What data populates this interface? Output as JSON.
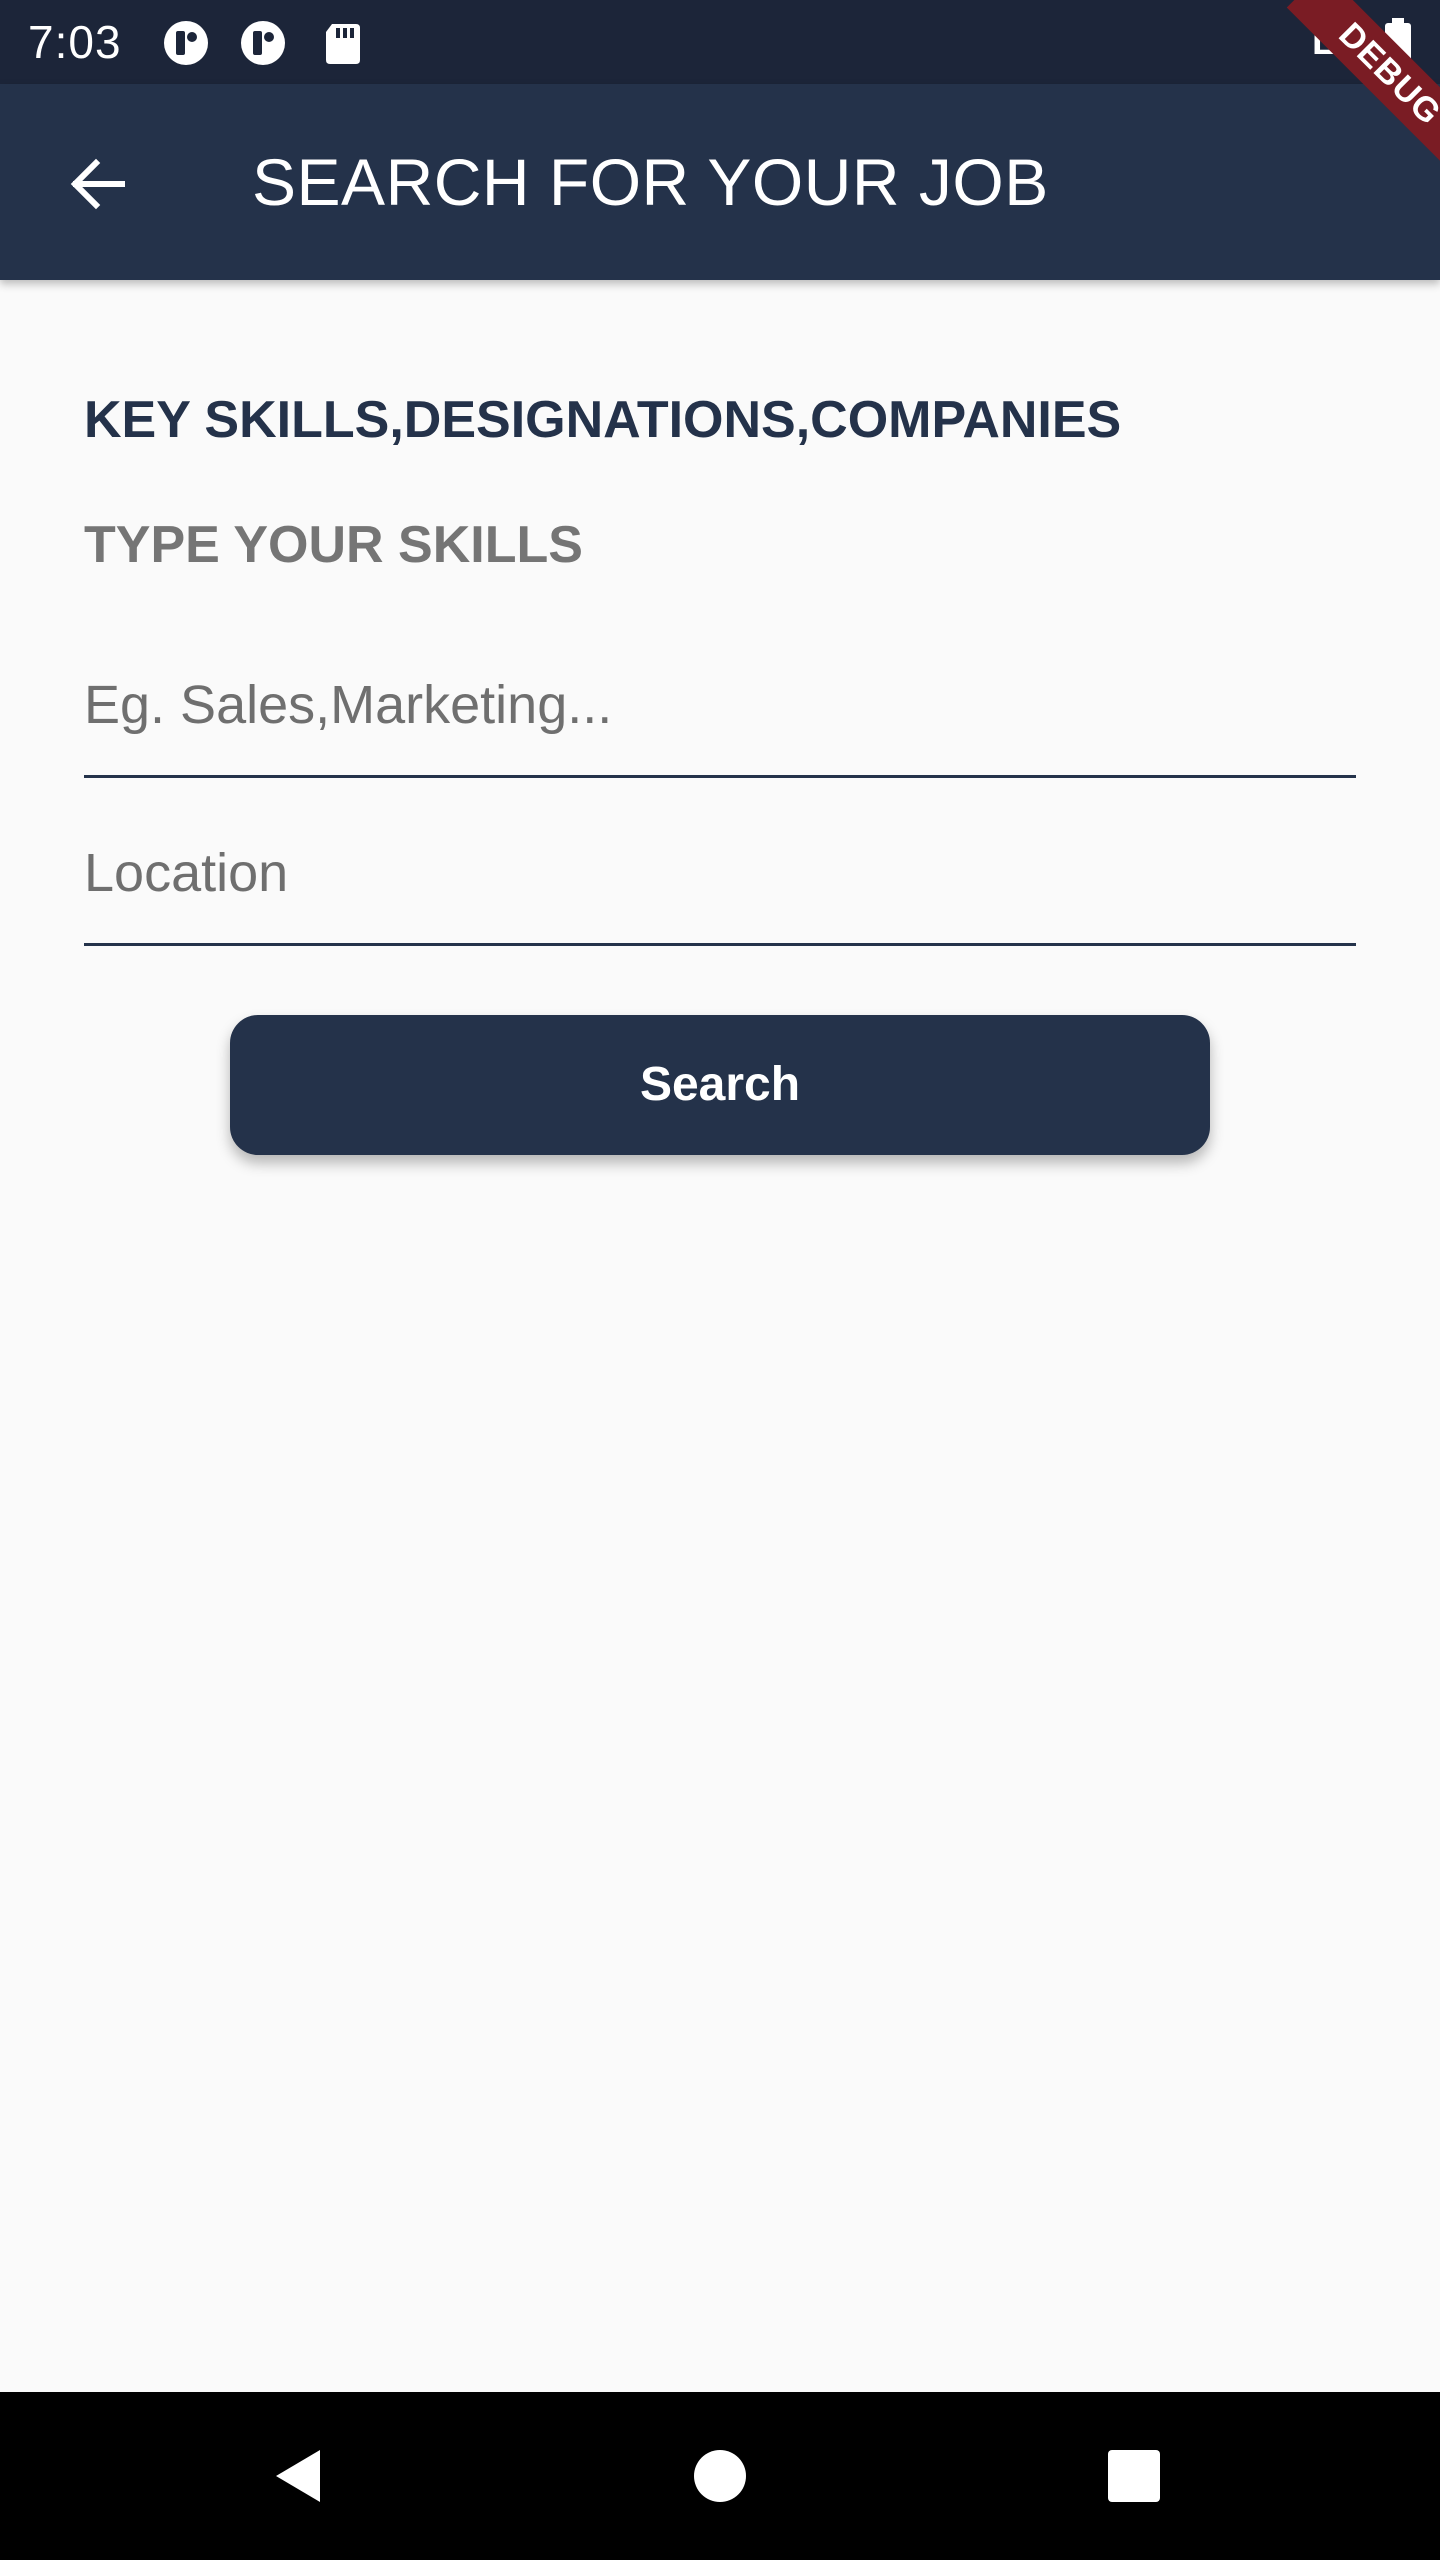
{
  "status_bar": {
    "time": "7:03",
    "icons": [
      "notification-app-icon",
      "notification-app-icon",
      "sd-card-icon"
    ],
    "signal": "LTE",
    "battery": "battery-icon"
  },
  "debug_banner": {
    "label": "DEBUG",
    "color": "#7a1c24"
  },
  "app_bar": {
    "back_icon": "arrow-back-icon",
    "title": "SEARCH FOR YOUR JOB",
    "color": "#24324a"
  },
  "content": {
    "heading": "KEY SKILLS,DESIGNATIONS,COMPANIES",
    "subheading": "TYPE YOUR SKILLS",
    "skills_field": {
      "placeholder": "Eg. Sales,Marketing...",
      "value": ""
    },
    "location_field": {
      "placeholder": "Location",
      "value": ""
    },
    "search_button": {
      "label": "Search"
    }
  },
  "nav_bar": {
    "back": "nav-back-icon",
    "home": "nav-home-icon",
    "recents": "nav-recents-icon"
  }
}
